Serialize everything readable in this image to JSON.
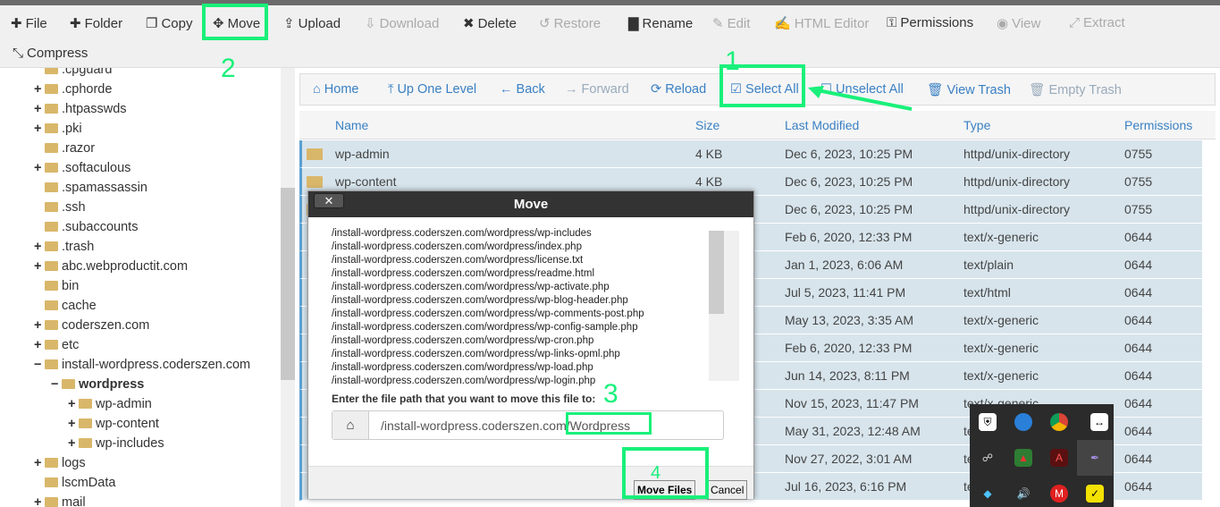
{
  "toolbar": {
    "items": [
      {
        "label": "File",
        "icon": "plus-icon",
        "enabled": true
      },
      {
        "label": "Folder",
        "icon": "plus-icon",
        "enabled": true
      },
      {
        "label": "Copy",
        "icon": "copy-icon",
        "enabled": true
      },
      {
        "label": "Move",
        "icon": "move-icon",
        "enabled": true
      },
      {
        "label": "Upload",
        "icon": "upload-icon",
        "enabled": true
      },
      {
        "label": "Download",
        "icon": "download-icon",
        "enabled": false
      },
      {
        "label": "Delete",
        "icon": "x-icon",
        "enabled": true
      },
      {
        "label": "Restore",
        "icon": "undo-icon",
        "enabled": false
      },
      {
        "label": "Rename",
        "icon": "file-icon",
        "enabled": true
      },
      {
        "label": "Edit",
        "icon": "pencil-icon",
        "enabled": false
      },
      {
        "label": "HTML Editor",
        "icon": "edit-icon",
        "enabled": false
      },
      {
        "label": "Permissions",
        "icon": "key-icon",
        "enabled": true
      },
      {
        "label": "View",
        "icon": "eye-icon",
        "enabled": false
      },
      {
        "label": "Extract",
        "icon": "expand-icon",
        "enabled": false
      },
      {
        "label": "Compress",
        "icon": "compress-icon",
        "enabled": true
      }
    ]
  },
  "sidebar": {
    "items": [
      {
        "label": ".cpguard",
        "exp": ""
      },
      {
        "label": ".cphorde",
        "exp": "+"
      },
      {
        "label": ".htpasswds",
        "exp": "+"
      },
      {
        "label": ".pki",
        "exp": "+"
      },
      {
        "label": ".razor",
        "exp": ""
      },
      {
        "label": ".softaculous",
        "exp": "+"
      },
      {
        "label": ".spamassassin",
        "exp": ""
      },
      {
        "label": ".ssh",
        "exp": ""
      },
      {
        "label": ".subaccounts",
        "exp": ""
      },
      {
        "label": ".trash",
        "exp": "+"
      },
      {
        "label": "abc.webproductit.com",
        "exp": "+"
      },
      {
        "label": "bin",
        "exp": ""
      },
      {
        "label": "cache",
        "exp": ""
      },
      {
        "label": "coderszen.com",
        "exp": "+"
      },
      {
        "label": "etc",
        "exp": "+"
      },
      {
        "label": "install-wordpress.coderszen.com",
        "exp": "−"
      },
      {
        "label": "wordpress",
        "exp": "−"
      },
      {
        "label": "wp-admin",
        "exp": "+"
      },
      {
        "label": "wp-content",
        "exp": "+"
      },
      {
        "label": "wp-includes",
        "exp": "+"
      },
      {
        "label": "logs",
        "exp": "+"
      },
      {
        "label": "lscmData",
        "exp": ""
      },
      {
        "label": "mail",
        "exp": "+"
      }
    ]
  },
  "nav": {
    "items": [
      {
        "label": "Home",
        "icon": "home-icon",
        "enabled": true
      },
      {
        "label": "Up One Level",
        "icon": "level-up-icon",
        "enabled": true
      },
      {
        "label": "Back",
        "icon": "arrow-left-icon",
        "enabled": true
      },
      {
        "label": "Forward",
        "icon": "arrow-right-icon",
        "enabled": false
      },
      {
        "label": "Reload",
        "icon": "reload-icon",
        "enabled": true
      },
      {
        "label": "Select All",
        "icon": "check-square-icon",
        "enabled": true
      },
      {
        "label": "Unselect All",
        "icon": "square-icon",
        "enabled": true
      },
      {
        "label": "View Trash",
        "icon": "trash-icon",
        "enabled": true
      },
      {
        "label": "Empty Trash",
        "icon": "trash-icon",
        "enabled": false
      }
    ]
  },
  "table": {
    "headers": [
      "Name",
      "Size",
      "Last Modified",
      "Type",
      "Permissions"
    ],
    "rows": [
      [
        "wp-admin",
        "4 KB",
        "Dec 6, 2023, 10:25 PM",
        "httpd/unix-directory",
        "0755"
      ],
      [
        "wp-content",
        "4 KB",
        "Dec 6, 2023, 10:25 PM",
        "httpd/unix-directory",
        "0755"
      ],
      [
        "",
        "",
        "Dec 6, 2023, 10:25 PM",
        "httpd/unix-directory",
        "0755"
      ],
      [
        "",
        "",
        "Feb 6, 2020, 12:33 PM",
        "text/x-generic",
        "0644"
      ],
      [
        "",
        "",
        "Jan 1, 2023, 6:06 AM",
        "text/plain",
        "0644"
      ],
      [
        "",
        "",
        "Jul 5, 2023, 11:41 PM",
        "text/html",
        "0644"
      ],
      [
        "",
        "",
        "May 13, 2023, 3:35 AM",
        "text/x-generic",
        "0644"
      ],
      [
        "",
        "",
        "Feb 6, 2020, 12:33 PM",
        "text/x-generic",
        "0644"
      ],
      [
        "",
        "",
        "Jun 14, 2023, 8:11 PM",
        "text/x-generic",
        "0644"
      ],
      [
        "",
        "",
        "Nov 15, 2023, 11:47 PM",
        "text/x-generic",
        "0644"
      ],
      [
        "",
        "",
        "May 31, 2023, 12:48 AM",
        "te",
        "0644"
      ],
      [
        "",
        "",
        "Nov 27, 2022, 3:01 AM",
        "te",
        "0644"
      ],
      [
        "",
        "",
        "Jul 16, 2023, 6:16 PM",
        "te",
        "0644"
      ]
    ]
  },
  "dialog": {
    "title": "Move",
    "close": "✕",
    "files": [
      "/install-wordpress.coderszen.com/wordpress/wp-includes",
      "/install-wordpress.coderszen.com/wordpress/index.php",
      "/install-wordpress.coderszen.com/wordpress/license.txt",
      "/install-wordpress.coderszen.com/wordpress/readme.html",
      "/install-wordpress.coderszen.com/wordpress/wp-activate.php",
      "/install-wordpress.coderszen.com/wordpress/wp-blog-header.php",
      "/install-wordpress.coderszen.com/wordpress/wp-comments-post.php",
      "/install-wordpress.coderszen.com/wordpress/wp-config-sample.php",
      "/install-wordpress.coderszen.com/wordpress/wp-cron.php",
      "/install-wordpress.coderszen.com/wordpress/wp-links-opml.php",
      "/install-wordpress.coderszen.com/wordpress/wp-load.php",
      "/install-wordpress.coderszen.com/wordpress/wp-login.php"
    ],
    "prompt": "Enter the file path that you want to move this file to:",
    "path_value": "/install-wordpress.coderszen.com/Wordpress",
    "move_label": "Move Files",
    "cancel_label": "Cancel"
  },
  "annotations": [
    "1",
    "2",
    "3",
    "4"
  ],
  "colors": {
    "annotation": "#19f07a",
    "link": "#3a80c4",
    "selected_row": "#d7e4ec"
  }
}
